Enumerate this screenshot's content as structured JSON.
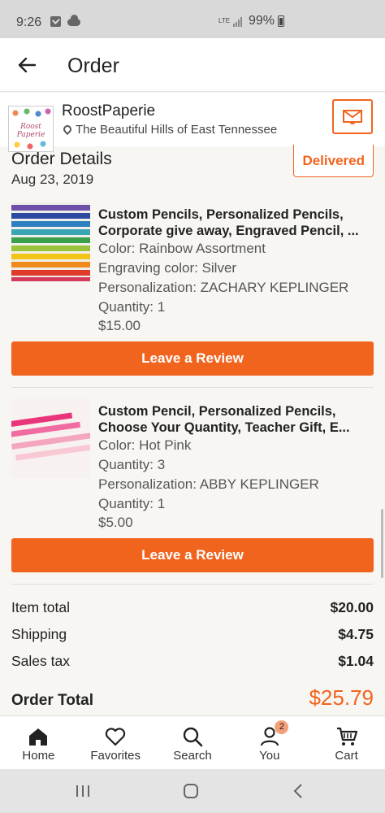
{
  "status_bar": {
    "time": "9:26",
    "network": "LTE",
    "battery": "99%"
  },
  "app_bar": {
    "title": "Order"
  },
  "shop": {
    "name": "RoostPaperie",
    "logo_text": "Roost Paperie",
    "location": "The Beautiful Hills of East Tennessee"
  },
  "order": {
    "details_title": "Order Details",
    "date": "Aug 23, 2019",
    "status": "Delivered"
  },
  "items": [
    {
      "title_line1": "Custom Pencils, Personalized Pencils,",
      "title_line2": "Corporate give away, Engraved Pencil, ...",
      "lines": [
        "Color: Rainbow Assortment",
        "Engraving color: Silver",
        "Personalization: ZACHARY KEPLINGER",
        "Quantity: 1",
        "$15.00"
      ],
      "review_label": "Leave a Review"
    },
    {
      "title_line1": "Custom Pencil, Personalized Pencils,",
      "title_line2": "Choose Your Quantity, Teacher Gift, E...",
      "lines": [
        "Color: Hot Pink",
        "Quantity: 3",
        "Personalization: ABBY KEPLINGER",
        "Quantity: 1",
        "$5.00"
      ],
      "review_label": "Leave a Review"
    }
  ],
  "summary": {
    "item_total_label": "Item total",
    "item_total": "$20.00",
    "shipping_label": "Shipping",
    "shipping": "$4.75",
    "tax_label": "Sales tax",
    "tax": "$1.04",
    "order_total_label": "Order Total",
    "order_total": "$25.79"
  },
  "bottom_nav": {
    "home": "Home",
    "favorites": "Favorites",
    "search": "Search",
    "you": "You",
    "you_badge": "2",
    "cart": "Cart"
  },
  "colors": {
    "accent": "#f1641e",
    "badge": "#f4a07a"
  },
  "icons": [
    "back-arrow-icon",
    "location-pin-icon",
    "mail-icon",
    "home-icon",
    "heart-icon",
    "search-icon",
    "person-icon",
    "cart-icon",
    "recents-icon",
    "home-circle-icon",
    "back-chevron-icon"
  ]
}
